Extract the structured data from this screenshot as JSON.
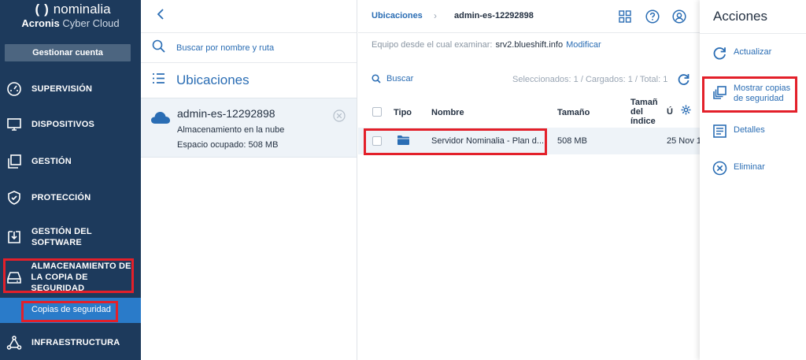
{
  "brand": {
    "name": "nominalia",
    "prefix": "Acronis",
    "product": "Cyber Cloud"
  },
  "sidebar": {
    "manage_button": "Gestionar cuenta",
    "items": [
      {
        "label": "SUPERVISIÓN",
        "icon": "gauge-icon"
      },
      {
        "label": "DISPOSITIVOS",
        "icon": "monitor-icon"
      },
      {
        "label": "GESTIÓN",
        "icon": "stack-icon"
      },
      {
        "label": "PROTECCIÓN",
        "icon": "shield-icon"
      },
      {
        "label_line1": "GESTIÓN DEL",
        "label_line2": "SOFTWARE",
        "icon": "download-box-icon"
      },
      {
        "label_line1": "ALMACENAMIENTO DE",
        "label_line2": "LA COPIA DE SEGURIDAD",
        "icon": "drive-icon"
      },
      {
        "label": "INFRAESTRUCTURA",
        "icon": "network-icon"
      }
    ],
    "subitem": "Copias de seguridad"
  },
  "locations": {
    "search_placeholder": "Buscar por nombre y ruta",
    "title": "Ubicaciones",
    "card": {
      "name": "admin-es-12292898",
      "type": "Almacenamiento en la nube",
      "space": "Espacio ocupado: 508 MB"
    }
  },
  "main": {
    "breadcrumb": {
      "root": "Ubicaciones",
      "current": "admin-es-12292898"
    },
    "machine_label": "Equipo desde el cual examinar:",
    "machine_value": "srv2.blueshift.info",
    "modify": "Modificar",
    "search": "Buscar",
    "stats": "Seleccionados: 1 / Cargados: 1 / Total: 1",
    "columns": {
      "type": "Tipo",
      "name": "Nombre",
      "size": "Tamaño",
      "index_size_1": "Tamañ",
      "index_size_2": "del",
      "index_size_3": "índice",
      "last": "Ú"
    },
    "row": {
      "name": "Servidor Nominalia - Plan d...",
      "size": "508 MB",
      "date": "25 Nov 1"
    }
  },
  "actions": {
    "title": "Acciones",
    "items": [
      {
        "label": "Actualizar",
        "icon": "refresh-icon"
      },
      {
        "label_line1": "Mostrar copias",
        "label_line2": "de seguridad",
        "icon": "copies-icon"
      },
      {
        "label": "Detalles",
        "icon": "details-icon"
      },
      {
        "label": "Eliminar",
        "icon": "delete-icon"
      }
    ]
  },
  "colors": {
    "sidebar_bg": "#1d3a5c",
    "accent_blue": "#2a6db4",
    "selected_blue": "#2a7bc9",
    "highlight_red": "#e3202a",
    "row_bg": "#eef3f8"
  }
}
